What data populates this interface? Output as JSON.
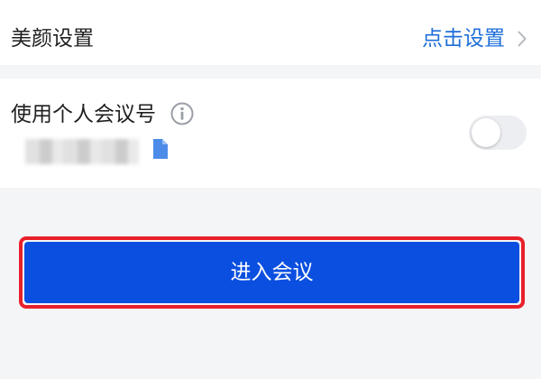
{
  "beauty": {
    "label": "美颜设置",
    "action": "点击设置"
  },
  "personal_meeting": {
    "label": "使用个人会议号",
    "id_value": "",
    "toggle_on": false
  },
  "join": {
    "label": "进入会议"
  },
  "colors": {
    "accent_blue": "#1e6fd9",
    "button_blue": "#0a4fe0",
    "highlight_red": "#e8202a"
  }
}
